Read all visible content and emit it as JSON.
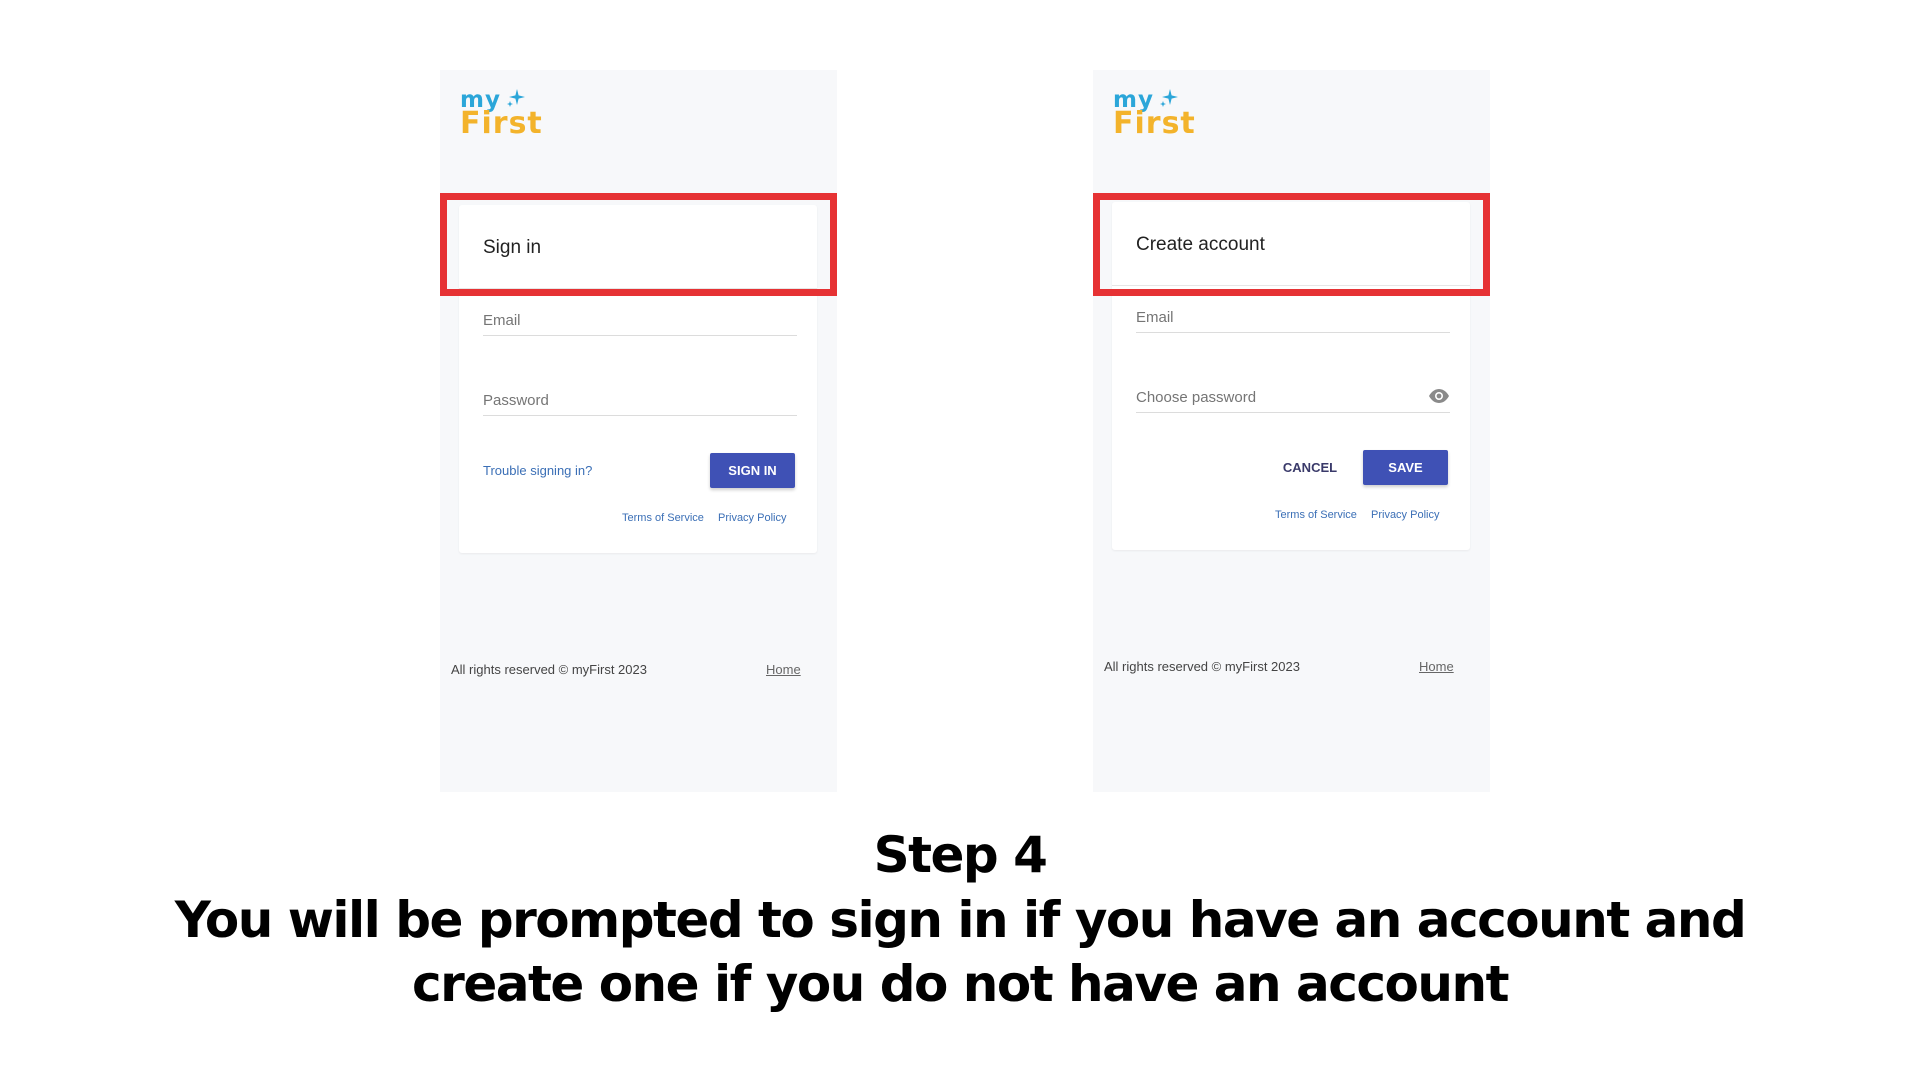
{
  "brand": {
    "logo_top": "my",
    "logo_bottom": "First",
    "colors": {
      "my": "#2ba6d9",
      "first": "#f3b32b",
      "sparkle": "#2ba6d9"
    }
  },
  "signin_panel": {
    "title": "Sign in",
    "email_label": "Email",
    "password_label": "Password",
    "trouble_link": "Trouble signing in?",
    "submit_label": "SIGN IN",
    "terms": "Terms of Service",
    "privacy": "Privacy Policy",
    "footer_copy": "All rights reserved © myFirst 2023",
    "footer_home": "Home"
  },
  "create_panel": {
    "title": "Create account",
    "email_label": "Email",
    "password_label": "Choose password",
    "cancel_label": "CANCEL",
    "save_label": "SAVE",
    "terms": "Terms of Service",
    "privacy": "Privacy Policy",
    "footer_copy": "All rights reserved © myFirst 2023",
    "footer_home": "Home"
  },
  "caption": {
    "step": "Step 4",
    "line1": "You will be prompted to sign in if you have an account and",
    "line2": "create one if you do not have an account"
  },
  "colors": {
    "highlight": "#e63234",
    "primary_button": "#3f51b5",
    "link": "#3b6fb6",
    "panel_bg": "#f7f8fa"
  },
  "icons": {
    "sparkle": "sparkle-icon",
    "password_visibility": "eye-icon"
  }
}
